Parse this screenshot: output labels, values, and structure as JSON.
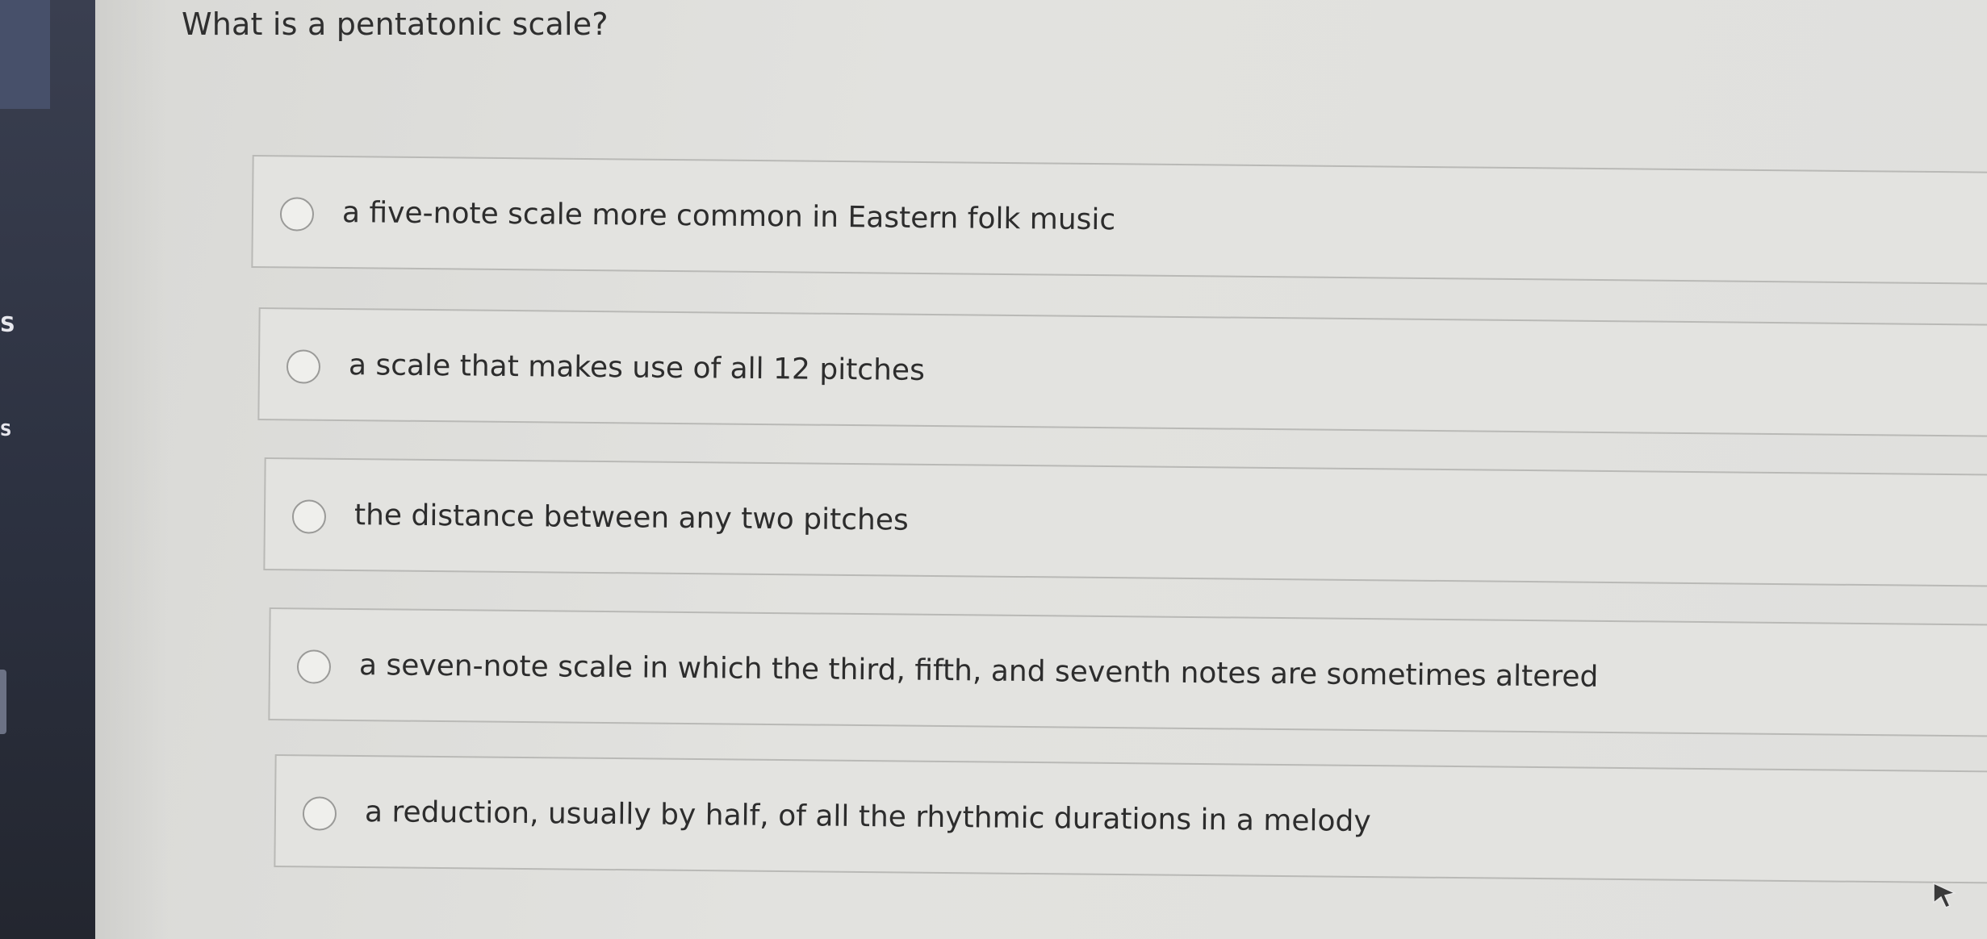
{
  "sidebar": {
    "letters": [
      "S",
      "S"
    ]
  },
  "question": {
    "text": "What is a pentatonic scale?"
  },
  "options": [
    {
      "label": "a five-note scale more common in Eastern folk music",
      "selected": false
    },
    {
      "label": "a scale that makes use of all 12 pitches",
      "selected": false
    },
    {
      "label": "the distance between any two pitches",
      "selected": false
    },
    {
      "label": "a seven-note scale in which the third, fifth, and seventh notes are sometimes altered",
      "selected": false
    },
    {
      "label": "a reduction, usually by half, of all the rhythmic durations in a melody",
      "selected": false
    }
  ]
}
